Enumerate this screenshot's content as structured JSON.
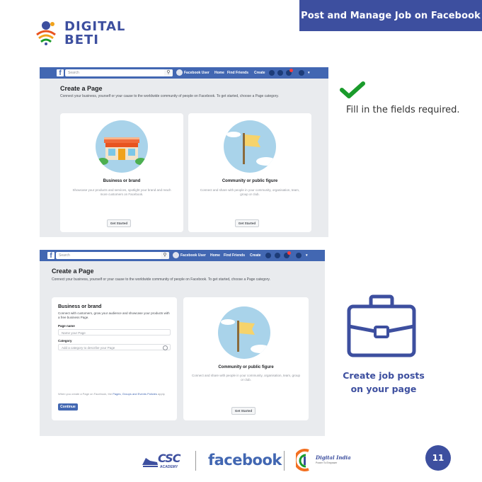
{
  "header": {
    "title": "Post and Manage Job on Facebook",
    "brand_line1": "DIGITAL",
    "brand_line2": "BETI"
  },
  "fb": {
    "search_placeholder": "Search",
    "user_name": "Facebook User",
    "nav_home": "Home",
    "nav_find_friends": "Find Friends",
    "nav_create": "Create"
  },
  "create_page": {
    "title": "Create a Page",
    "subtitle": "Connect your business, yourself or your cause to the worldwide community of people on Facebook. To get started, choose a Page category.",
    "business": {
      "title": "Business or brand",
      "desc": "Showcase your products and services, spotlight your brand and reach more customers on Facebook.",
      "button": "Get Started"
    },
    "community": {
      "title": "Community or public figure",
      "desc": "Connect and share with people in your community, organisation, team, group or club.",
      "button": "Get Started"
    }
  },
  "form": {
    "title": "Business or brand",
    "desc": "Connect with customers, grow your audience and showcase your products with a free business Page.",
    "page_name_label": "Page name",
    "page_name_placeholder": "Name your Page",
    "category_label": "Category",
    "category_placeholder": "Add a category to describe your Page",
    "terms_prefix": "When you create a Page on Facebook, the",
    "terms_link": "Pages, Groups and Events Policies",
    "terms_suffix": "apply.",
    "continue": "Continue"
  },
  "instructions": {
    "fill": "Fill in the fields required.",
    "jobs_line1": "Create job posts",
    "jobs_line2": "on your page"
  },
  "footer": {
    "csc_line1": "CSC",
    "csc_line2": "ACADEMY",
    "facebook": "facebook",
    "digital_india_line1": "Digital India",
    "digital_india_line2": "Power To Empower",
    "page_number": "11"
  },
  "colors": {
    "brand_blue": "#3d4f9f",
    "fb_blue": "#4267b2",
    "check_green": "#1a9b2b",
    "fb_bg": "#e9ebee"
  }
}
